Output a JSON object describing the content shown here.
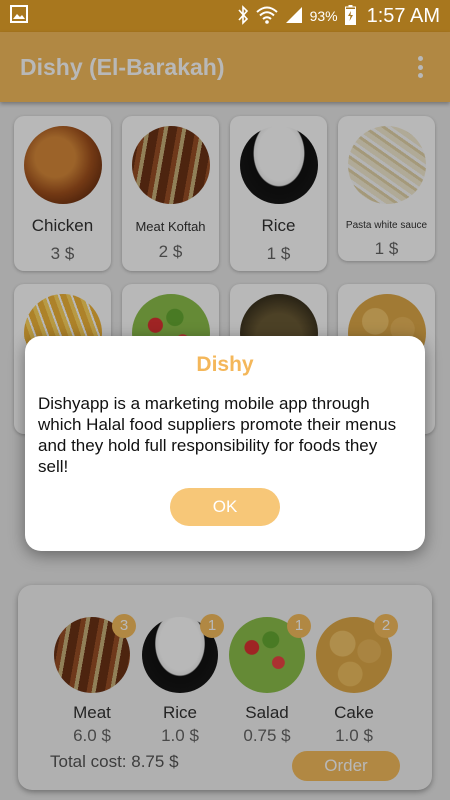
{
  "status_bar": {
    "battery": "93%",
    "time": "1:57 AM"
  },
  "app_bar": {
    "title": "Dishy (El-Barakah)"
  },
  "menu_items": [
    {
      "name": "Chicken",
      "price": "3 $"
    },
    {
      "name": "Meat Koftah",
      "price": "2 $"
    },
    {
      "name": "Rice",
      "price": "1 $"
    },
    {
      "name": "Pasta white sauce",
      "price": "1 $"
    }
  ],
  "tray": {
    "items": [
      {
        "name": "Meat",
        "price": "6.0 $",
        "count": "3"
      },
      {
        "name": "Rice",
        "price": "1.0 $",
        "count": "1"
      },
      {
        "name": "Salad",
        "price": "0.75 $",
        "count": "1"
      },
      {
        "name": "Cake",
        "price": "1.0 $",
        "count": "2"
      }
    ],
    "total": "Total cost: 8.75 $",
    "order_label": "Order"
  },
  "dialog": {
    "title": "Dishy",
    "message": "Dishyapp is a marketing mobile app through which Halal food suppliers promote their menus and they hold full responsibility for foods they sell!",
    "ok_label": "OK"
  }
}
